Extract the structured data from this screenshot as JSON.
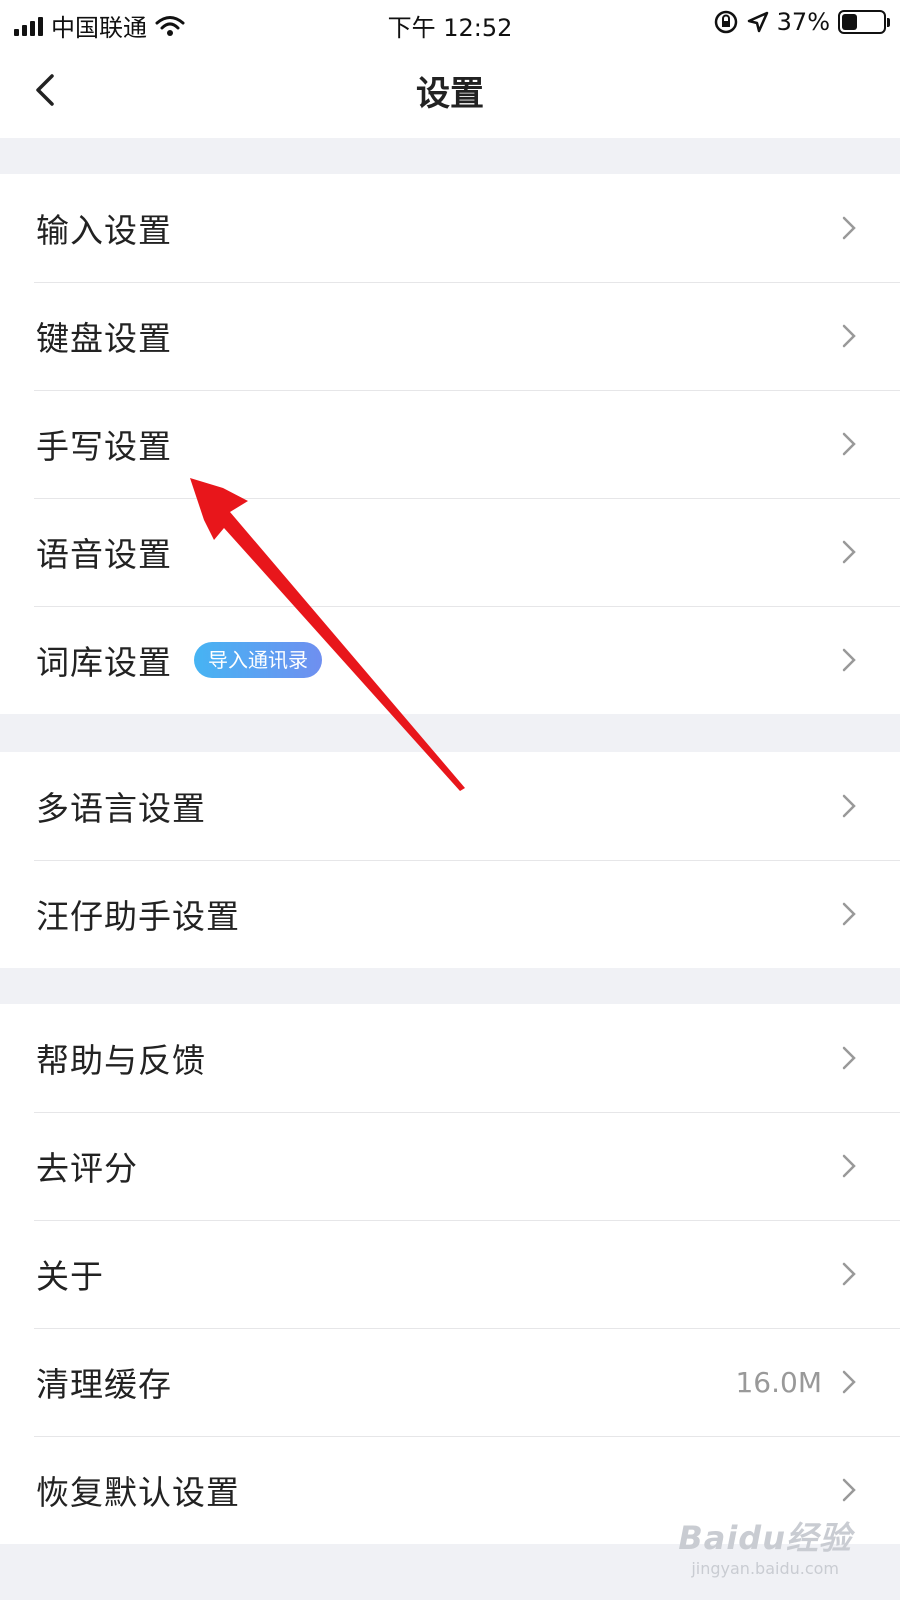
{
  "status_bar": {
    "carrier": "中国联通",
    "time": "下午 12:52",
    "battery_percent": "37%",
    "battery_level": 0.37,
    "icons": [
      "signal-icon",
      "wifi-icon",
      "orientation-lock-icon",
      "location-icon",
      "battery-icon"
    ]
  },
  "header": {
    "title": "设置",
    "back_icon": "back-chevron-icon"
  },
  "groups": [
    {
      "items": [
        {
          "label": "输入设置"
        },
        {
          "label": "键盘设置"
        },
        {
          "label": "手写设置"
        },
        {
          "label": "语音设置"
        },
        {
          "label": "词库设置",
          "badge": "导入通讯录"
        }
      ]
    },
    {
      "items": [
        {
          "label": "多语言设置"
        },
        {
          "label": "汪仔助手设置"
        }
      ]
    },
    {
      "items": [
        {
          "label": "帮助与反馈"
        },
        {
          "label": "去评分"
        },
        {
          "label": "关于"
        },
        {
          "label": "清理缓存",
          "value": "16.0M"
        },
        {
          "label": "恢复默认设置"
        }
      ]
    }
  ],
  "annotation": {
    "color": "#e8161b"
  },
  "watermark": {
    "logo": "Baidu经验",
    "url": "jingyan.baidu.com"
  },
  "colors": {
    "background": "#f0f1f5",
    "badge_start": "#46b4f3",
    "badge_end": "#6f8ff0",
    "separator": "#e6e6e8"
  }
}
